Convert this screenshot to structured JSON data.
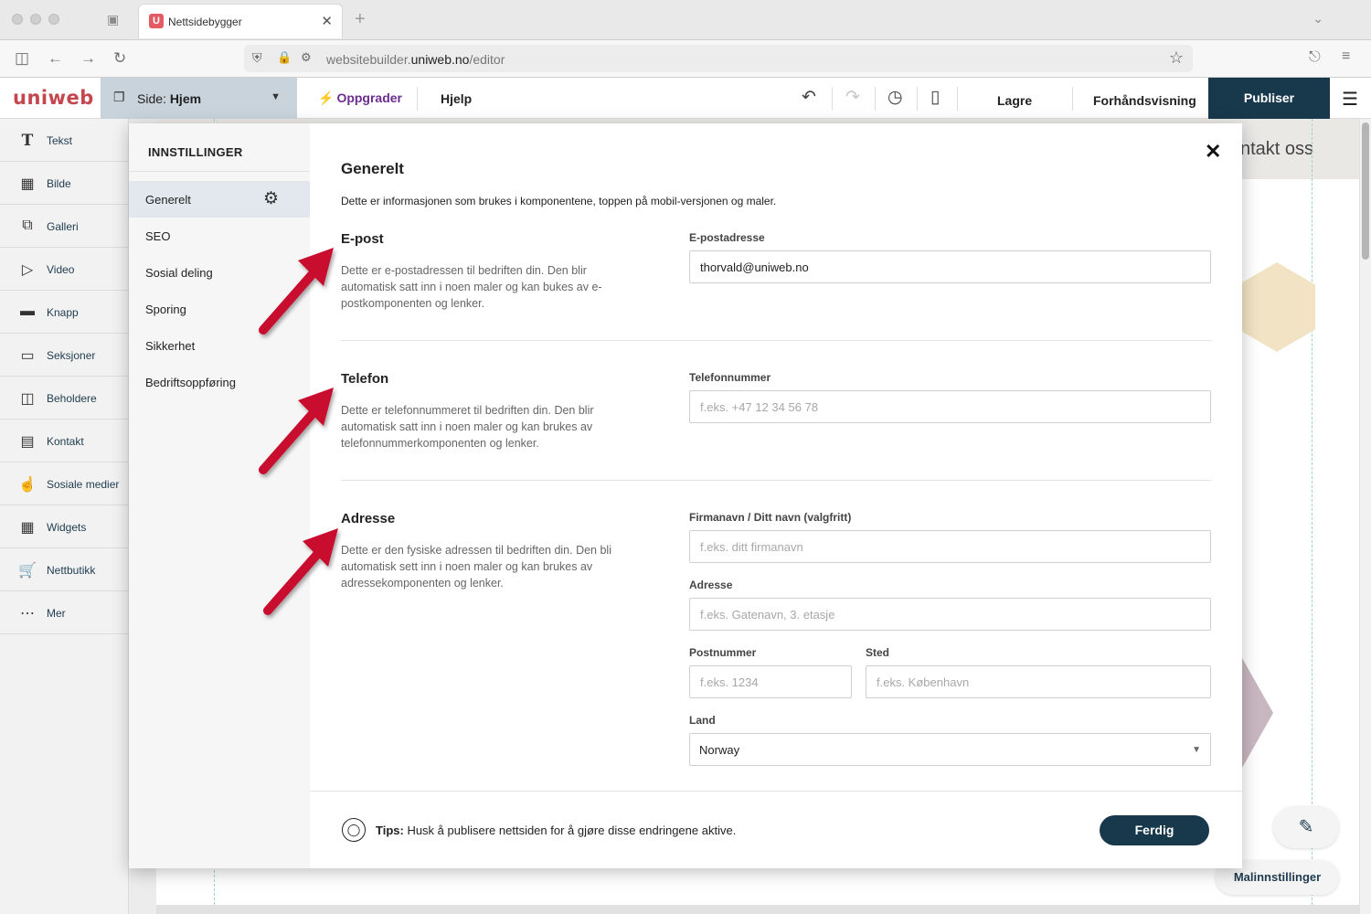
{
  "browser": {
    "tab_title": "Nettsidebygger",
    "tab_favicon": "U",
    "url_prefix": "websitebuilder.",
    "url_host": "uniweb.no",
    "url_path": "/editor"
  },
  "toolbar": {
    "logo": "uniweb",
    "page_prefix": "Side:",
    "page_name": "Hjem",
    "upgrade": "Oppgrader",
    "help": "Hjelp",
    "save": "Lagre",
    "preview": "Forhåndsvisning",
    "publish": "Publiser"
  },
  "sidebar": {
    "items": [
      {
        "label": "Tekst",
        "icon": "text-icon"
      },
      {
        "label": "Bilde",
        "icon": "image-icon"
      },
      {
        "label": "Galleri",
        "icon": "gallery-icon"
      },
      {
        "label": "Video",
        "icon": "video-icon"
      },
      {
        "label": "Knapp",
        "icon": "button-icon"
      },
      {
        "label": "Seksjoner",
        "icon": "sections-icon"
      },
      {
        "label": "Beholdere",
        "icon": "containers-icon"
      },
      {
        "label": "Kontakt",
        "icon": "contact-icon"
      },
      {
        "label": "Sosiale medier",
        "icon": "thumbs-up-icon"
      },
      {
        "label": "Widgets",
        "icon": "widgets-icon"
      },
      {
        "label": "Nettbutikk",
        "icon": "cart-icon"
      },
      {
        "label": "Mer",
        "icon": "more-icon"
      }
    ]
  },
  "canvas": {
    "nav_text": "ntakt oss",
    "template_settings": "Malinnstillinger"
  },
  "modal": {
    "nav_title": "INNSTILLINGER",
    "nav_items": [
      "Generelt",
      "SEO",
      "Sosial deling",
      "Sporing",
      "Sikkerhet",
      "Bedriftsoppføring"
    ],
    "title": "Generelt",
    "intro": "Dette er informasjonen som brukes i komponentene, toppen på mobil-versjonen og maler.",
    "email": {
      "title": "E-post",
      "desc": "Dette er e-postadressen til bedriften din. Den blir automatisk satt inn i noen maler og kan bukes av e-postkomponenten og lenker.",
      "label": "E-postadresse",
      "value": "thorvald@uniweb.no"
    },
    "phone": {
      "title": "Telefon",
      "desc": "Dette er telefonnummeret til bedriften din. Den blir automatisk satt inn i noen maler og kan brukes av telefonnummerkomponenten og lenker.",
      "label": "Telefonnummer",
      "placeholder": "f.eks. +47 12 34 56 78"
    },
    "address": {
      "title": "Adresse",
      "desc": "Dette er den fysiske adressen til bedriften din. Den bli automatisk sett inn i noen maler og kan brukes av adressekomponenten og lenker.",
      "company_label": "Firmanavn / Ditt navn (valgfritt)",
      "company_placeholder": "f.eks. ditt firmanavn",
      "street_label": "Adresse",
      "street_placeholder": "f.eks. Gatenavn, 3. etasje",
      "zip_label": "Postnummer",
      "zip_placeholder": "f.eks. 1234",
      "city_label": "Sted",
      "city_placeholder": "f.eks. København",
      "country_label": "Land",
      "country_value": "Norway"
    },
    "tip_bold": "Tips:",
    "tip_text": " Husk å publisere nettsiden for å gjøre disse endringene aktive.",
    "done": "Ferdig"
  },
  "colors": {
    "brand": "#c4474f",
    "primary": "#17394b",
    "upgrade": "#6b2d8f",
    "arrow": "#c8102e"
  }
}
